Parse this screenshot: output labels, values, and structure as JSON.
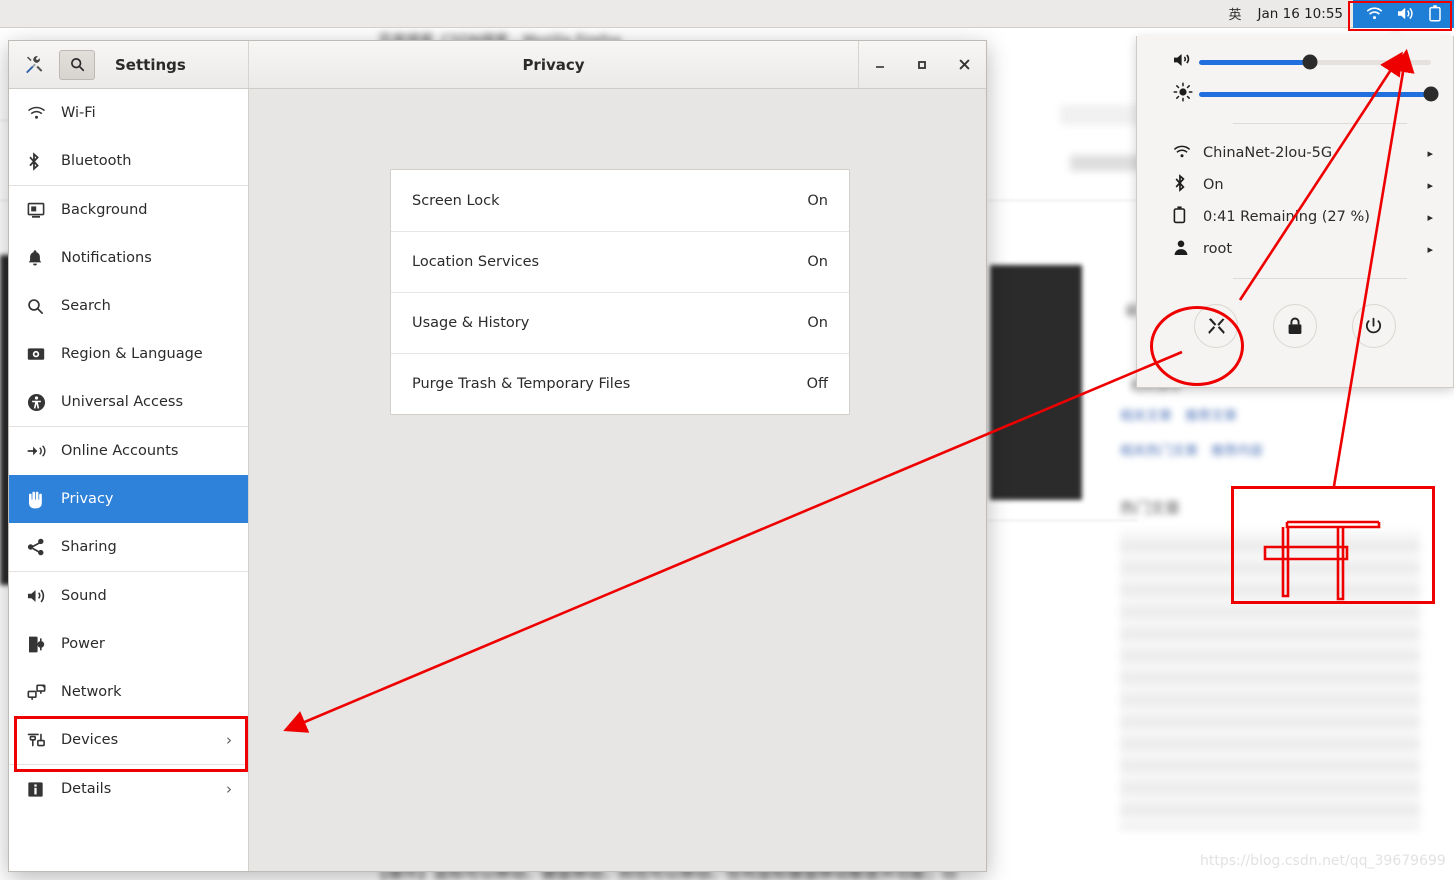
{
  "topbar": {
    "ime_indicator": "英",
    "clock": "Jan 16  10:55",
    "icons": [
      "wifi-icon",
      "volume-icon",
      "battery-icon"
    ],
    "indicator_bg_color": "#1f7fd6"
  },
  "system_menu": {
    "volume": {
      "icon": "volume-icon",
      "value": 48
    },
    "brightness": {
      "icon": "brightness-icon",
      "value": 100
    },
    "items": [
      {
        "icon": "wifi-icon",
        "label": "ChinaNet-2lou-5G",
        "chevron": "▸"
      },
      {
        "icon": "bluetooth-icon",
        "label": "On",
        "chevron": "▸"
      },
      {
        "icon": "battery-icon",
        "label": "0:41 Remaining (27 %)",
        "chevron": "▸"
      },
      {
        "icon": "user-icon",
        "label": "root",
        "chevron": "▸"
      }
    ],
    "actions": [
      {
        "name": "settings-button",
        "icon": "tools-icon"
      },
      {
        "name": "lock-button",
        "icon": "lock-icon"
      },
      {
        "name": "power-button",
        "icon": "power-icon"
      }
    ]
  },
  "window": {
    "app_title": "Settings",
    "page_title": "Privacy",
    "header_icons": {
      "tools": "tools-icon",
      "search": "search-icon"
    },
    "controls": {
      "minimize": "−",
      "maximize": "▫",
      "close": "✕"
    }
  },
  "sidebar": {
    "items": [
      {
        "label": "Wi-Fi",
        "icon": "wifi-icon",
        "chevron": "",
        "active": false,
        "sep_after": false
      },
      {
        "label": "Bluetooth",
        "icon": "bluetooth-icon",
        "chevron": "",
        "active": false,
        "sep_after": true
      },
      {
        "label": "Background",
        "icon": "background-icon",
        "chevron": "",
        "active": false,
        "sep_after": false
      },
      {
        "label": "Notifications",
        "icon": "bell-icon",
        "chevron": "",
        "active": false,
        "sep_after": false
      },
      {
        "label": "Search",
        "icon": "search-icon",
        "chevron": "",
        "active": false,
        "sep_after": false
      },
      {
        "label": "Region & Language",
        "icon": "region-icon",
        "chevron": "",
        "active": false,
        "sep_after": false
      },
      {
        "label": "Universal Access",
        "icon": "accessibility-icon",
        "chevron": "",
        "active": false,
        "sep_after": true
      },
      {
        "label": "Online Accounts",
        "icon": "online-accounts-icon",
        "chevron": "",
        "active": false,
        "sep_after": false
      },
      {
        "label": "Privacy",
        "icon": "hand-icon",
        "chevron": "",
        "active": true,
        "sep_after": false
      },
      {
        "label": "Sharing",
        "icon": "share-icon",
        "chevron": "",
        "active": false,
        "sep_after": true
      },
      {
        "label": "Sound",
        "icon": "volume-icon",
        "chevron": "",
        "active": false,
        "sep_after": false
      },
      {
        "label": "Power",
        "icon": "power-plug-icon",
        "chevron": "",
        "active": false,
        "sep_after": false
      },
      {
        "label": "Network",
        "icon": "network-icon",
        "chevron": "",
        "active": false,
        "sep_after": false
      },
      {
        "label": "Devices",
        "icon": "devices-icon",
        "chevron": "›",
        "active": false,
        "sep_after": true
      },
      {
        "label": "Details",
        "icon": "info-icon",
        "chevron": "›",
        "active": false,
        "sep_after": false
      }
    ]
  },
  "privacy": {
    "rows": [
      {
        "label": "Screen Lock",
        "value": "On"
      },
      {
        "label": "Location Services",
        "value": "On"
      },
      {
        "label": "Usage & History",
        "value": "On"
      },
      {
        "label": "Purge Trash & Temporary Files",
        "value": "Off"
      }
    ]
  },
  "annotations": {
    "color": "#ee0000",
    "boxes": [
      "topbar-indicators-box",
      "devices-sidebar-box",
      "handwritten-char-box"
    ],
    "ellipse": "settings-action-button-circle",
    "arrows": [
      "arrow-to-devices",
      "arrow-to-topbar-indicators"
    ],
    "handwritten_character": "开"
  },
  "watermark": {
    "text": "https://blog.csdn.net/qq_39679699"
  },
  "background": {
    "blurred_lines": [
      "百度搜索_CSDN搜索 - Mozilla Firefox",
      "相关推荐",
      "热门文章",
      "最新评论",
      "【操作】鼠标可以移动、键盘移动、则也可以移动、任何鼠标键盘移动都是开功能；功"
    ]
  }
}
